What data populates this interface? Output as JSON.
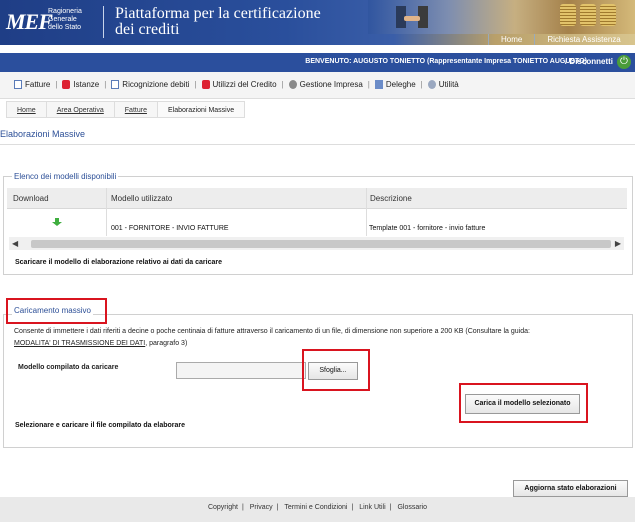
{
  "header": {
    "logo_text": "MEF",
    "logo_subtitle": [
      "Ragioneria",
      "Generale",
      "dello Stato"
    ],
    "app_title_line1": "Piattaforma per la certificazione",
    "app_title_line2": "dei crediti",
    "links": [
      "Home",
      "Richiesta Assistenza"
    ]
  },
  "userbar": {
    "welcome": "BENVENUTO: AUGUSTO TONIETTO (Rappresentante Impresa TONIETTO AUGUSTO)",
    "logout": "/ Disconnetti"
  },
  "menu": {
    "items": [
      "Fatture",
      "Istanze",
      "Ricognizione debiti",
      "Utilizzi del Credito",
      "Gestione Impresa",
      "Deleghe",
      "Utilità"
    ]
  },
  "breadcrumb": [
    "Home",
    "Area Operativa",
    "Fatture",
    "Elaborazioni Massive"
  ],
  "page_title": "Elaborazioni Massive",
  "models": {
    "legend": "Elenco dei modelli disponibili",
    "columns": [
      "Download",
      "Modello utilizzato",
      "Descrizione"
    ],
    "rows": [
      {
        "model": "001 - FORNITORE - INVIO FATTURE",
        "description": "Template 001 - fornitore - invio fatture"
      }
    ],
    "note": "Scaricare il modello di elaborazione relativo ai dati da caricare"
  },
  "upload": {
    "legend": "Caricamento massivo",
    "description_before": "Consente di immettere i dati riferiti a decine o poche centinaia di fatture attraverso il caricamento di un file, di dimensione non superiore a 200 KB (Consultare la guida:",
    "guide_link": "MODALITA' DI TRASMISSIONE DEI DATI",
    "description_after": ", paragrafo 3)",
    "file_label": "Modello compilato da caricare",
    "browse_button": "Sfoglia...",
    "upload_button": "Carica il modello selezionato",
    "note": "Selezionare e caricare il file compilato da elaborare"
  },
  "refresh_button": "Aggiorna stato elaborazioni",
  "footer": {
    "links": [
      "Copyright",
      "Privacy",
      "Termini e Condizioni",
      "Link Utili",
      "Glossario"
    ]
  },
  "colors": {
    "header_blue": "#1f3e86",
    "bar_blue": "#2b4f9d",
    "title_blue": "#2c4f97",
    "highlight_red": "#d9141f",
    "download_green": "#3fae3f"
  }
}
